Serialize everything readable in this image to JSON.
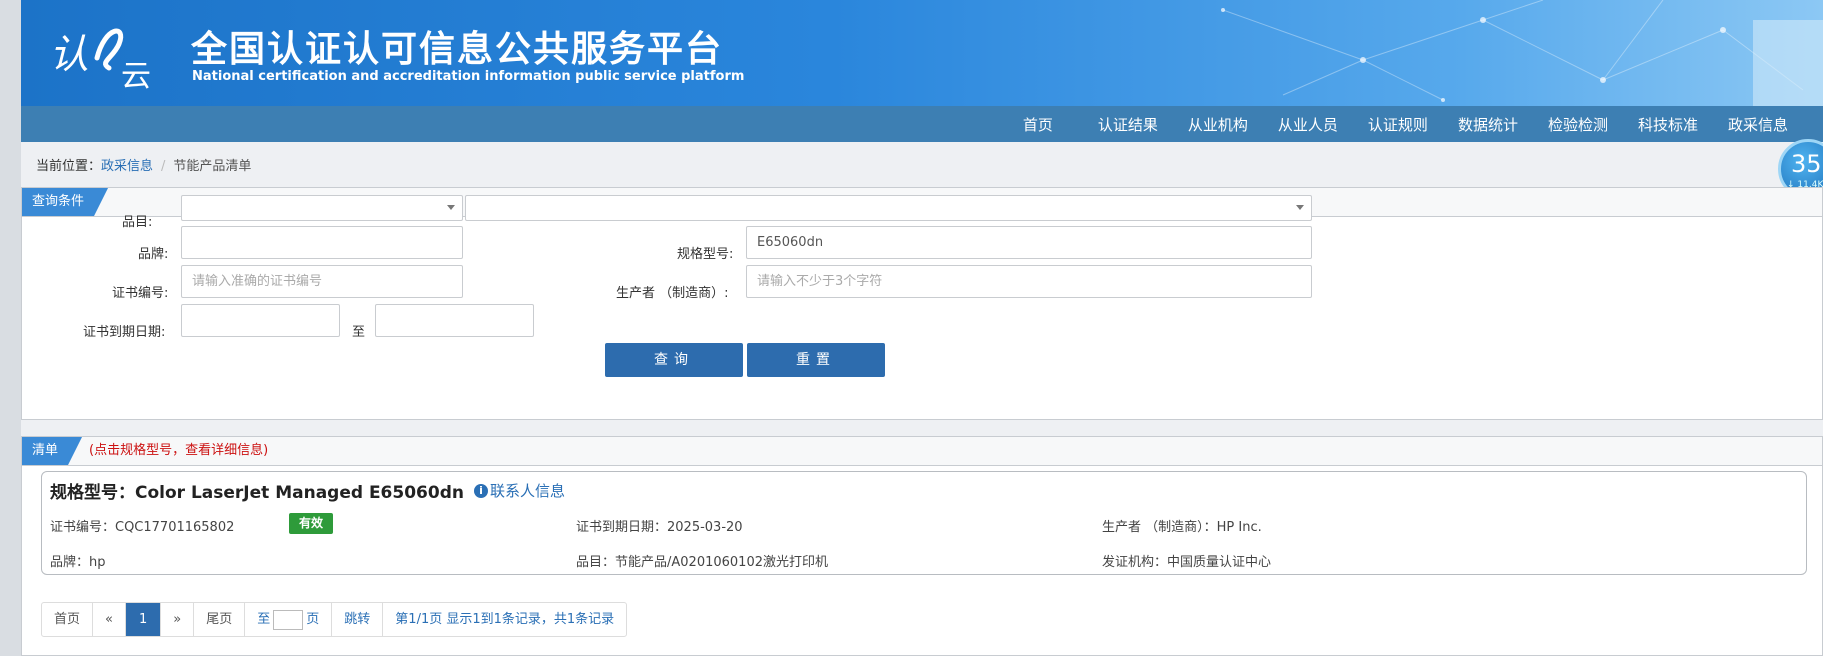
{
  "header": {
    "title": "全国认证认可信息公共服务平台",
    "subtitle": "National certification and accreditation information public service platform",
    "logo_text_1": "认",
    "logo_text_2": "云"
  },
  "nav": {
    "items": [
      "首页",
      "认证结果",
      "从业机构",
      "从业人员",
      "认证规则",
      "数据统计",
      "检验检测",
      "科技标准",
      "政采信息"
    ]
  },
  "breadcrumb": {
    "prefix": "当前位置：",
    "section": "政采信息",
    "current": "节能产品清单"
  },
  "speed_badge": {
    "value": "35",
    "rate": "↓ 11.4K"
  },
  "query": {
    "tab": "查询条件",
    "category_label": "品目:",
    "brand_label": "品牌:",
    "model_label": "规格型号:",
    "model_value": "E65060dn",
    "cert_no_label": "证书编号:",
    "cert_no_placeholder": "请输入准确的证书编号",
    "maker_label": "生产者 （制造商）:",
    "maker_placeholder": "请输入不少于3个字符",
    "expiry_label": "证书到期日期:",
    "to_label": "至",
    "search_button": "查询",
    "reset_button": "重置"
  },
  "list": {
    "tab": "清单",
    "hint": "(点击规格型号，查看详细信息)",
    "record": {
      "title": "规格型号：Color LaserJet Managed E65060dn",
      "contact": "联系人信息",
      "cert_no": "证书编号：CQC17701165802",
      "status": "有效",
      "expiry": "证书到期日期：2025-03-20",
      "maker": "生产者 （制造商）：HP Inc.",
      "brand": "品牌：hp",
      "category": "品目：节能产品/A0201060102激光打印机",
      "issuer": "发证机构：中国质量认证中心"
    }
  },
  "pager": {
    "first": "首页",
    "prev": "«",
    "current": "1",
    "next": "»",
    "last": "尾页",
    "goto_prefix": "至",
    "goto_suffix": "页",
    "jump": "跳转",
    "summary": "第1/1页 显示1到1条记录，共1条记录"
  }
}
